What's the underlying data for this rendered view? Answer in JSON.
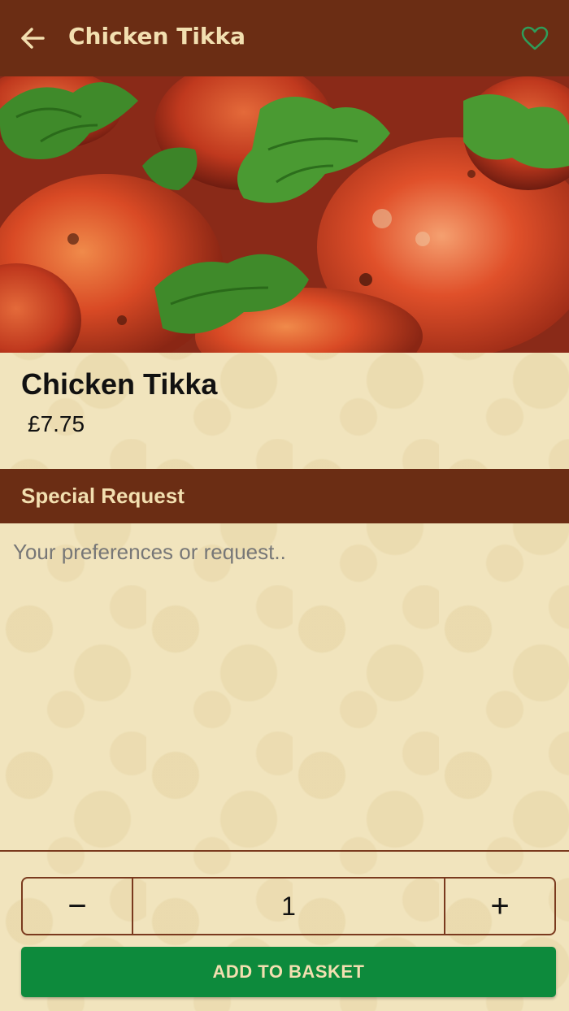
{
  "header": {
    "title": "Chicken Tikka",
    "back_icon": "arrow-left-icon",
    "favorite_icon": "heart-outline-icon"
  },
  "hero": {
    "image_subject": "food-photo"
  },
  "item": {
    "name": "Chicken Tikka",
    "price": "£7.75"
  },
  "special_request": {
    "title": "Special Request",
    "placeholder": "Your preferences or request..",
    "value": ""
  },
  "quantity": {
    "minus_label": "−",
    "value": "1",
    "plus_label": "+"
  },
  "add_button": {
    "label": "ADD TO BASKET"
  },
  "colors": {
    "header_bg": "#6b2d14",
    "header_text": "#f2dfb0",
    "page_bg": "#f1e4bd",
    "button_green": "#0d8a3c",
    "heart_green": "#2e9e5a"
  }
}
